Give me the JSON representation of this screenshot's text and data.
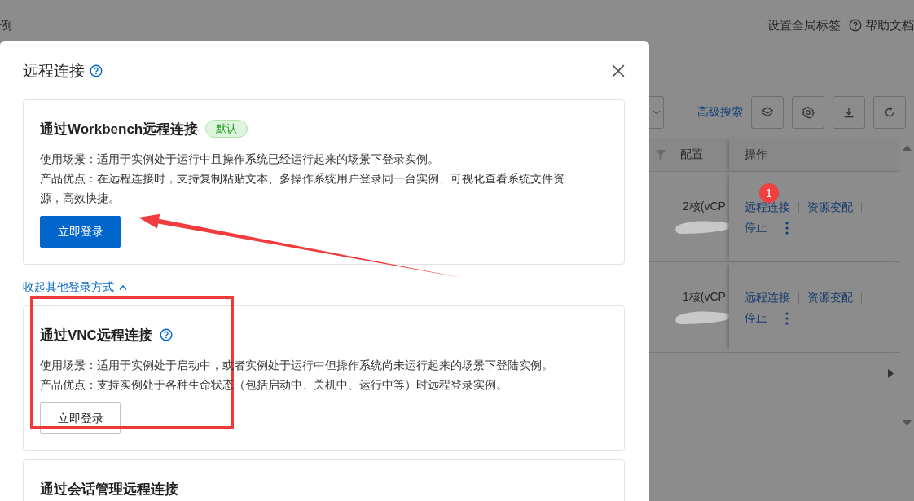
{
  "background": {
    "top_left_text": "例",
    "top_links": [
      {
        "kind": "text",
        "label": "设置全局标签"
      },
      {
        "kind": "help",
        "label": "帮助文档"
      }
    ],
    "toolbar": {
      "advanced_search": "高级搜索",
      "buttons": [
        {
          "kind": "layers"
        },
        {
          "kind": "settings"
        },
        {
          "kind": "download"
        },
        {
          "kind": "refresh"
        }
      ]
    },
    "table": {
      "columns": [
        "配置",
        "操作"
      ],
      "rows": [
        {
          "config": "2核(vCP",
          "actions": [
            {
              "label": "远程连接"
            },
            {
              "label": "资源变配"
            },
            {
              "label": "停止"
            }
          ]
        },
        {
          "config": "1核(vCP",
          "actions": [
            {
              "label": "远程连接"
            },
            {
              "label": "资源变配"
            },
            {
              "label": "停止"
            }
          ]
        }
      ]
    }
  },
  "dialog": {
    "title": "远程连接",
    "primary_method": {
      "title": "通过Workbench远程连接",
      "tag": "默认",
      "help": false,
      "lines": [
        "使用场景：适用于实例处于运行中且操作系统已经运行起来的场景下登录实例。",
        "产品优点：在远程连接时，支持复制粘贴文本、多操作系统用户登录同一台实例、可视化查看系统文件资源，高效快捷。"
      ],
      "button": {
        "label": "立即登录",
        "primary": true
      }
    },
    "collapse_link": "收起其他登录方式",
    "other_methods": [
      {
        "title": "通过VNC远程连接",
        "help": true,
        "lines": [
          "使用场景：适用于实例处于启动中，或者实例处于运行中但操作系统尚未运行起来的场景下登陆实例。",
          "产品优点：支持实例处于各种生命状态（包括启动中、关机中、运行中等）时远程登录实例。"
        ],
        "button": {
          "label": "立即登录",
          "primary": false
        }
      },
      {
        "title": "通过会话管理远程连接",
        "help": false
      }
    ]
  },
  "annotation": {
    "badge": "1"
  }
}
